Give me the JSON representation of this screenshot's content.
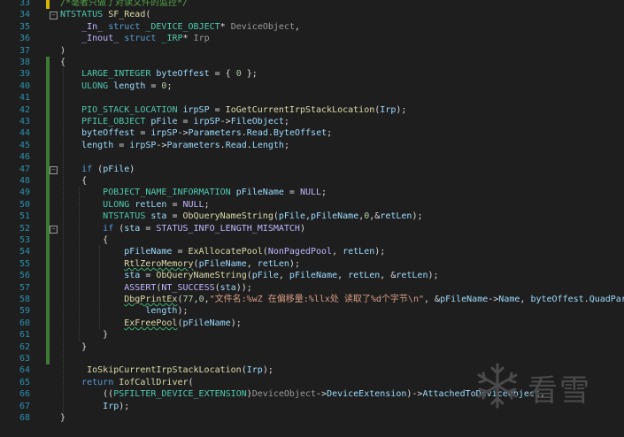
{
  "colors": {
    "background": "#1e1e1e",
    "line_number": "#2b91af",
    "keyword": "#569cd6",
    "type": "#4ec9b0",
    "function": "#dcdcaa",
    "string": "#d69d85",
    "comment": "#57a64a",
    "change_bar": "#3d7a35",
    "change_bar_modified": "#d6b400"
  },
  "lines": [
    {
      "n": "33",
      "tokens": [
        [
          "cm",
          "/*毫者只做了对读文件的监控*/"
        ]
      ]
    },
    {
      "n": "34",
      "tokens": [
        [
          "ty",
          "NTSTATUS"
        ],
        [
          "pl",
          " "
        ],
        [
          "fn",
          "SF_Read"
        ],
        [
          "pl",
          "("
        ]
      ]
    },
    {
      "n": "35",
      "tokens": [
        [
          "pl",
          "    "
        ],
        [
          "mac",
          "_In_"
        ],
        [
          "pl",
          " "
        ],
        [
          "kw",
          "struct"
        ],
        [
          "pl",
          " "
        ],
        [
          "ty",
          "_DEVICE_OBJECT"
        ],
        [
          "pl",
          "* "
        ],
        [
          "gray",
          "DeviceObject"
        ],
        [
          "pl",
          ","
        ]
      ]
    },
    {
      "n": "36",
      "tokens": [
        [
          "pl",
          "    "
        ],
        [
          "mac",
          "_Inout_"
        ],
        [
          "pl",
          " "
        ],
        [
          "kw",
          "struct"
        ],
        [
          "pl",
          " "
        ],
        [
          "ty",
          "_IRP"
        ],
        [
          "pl",
          "* "
        ],
        [
          "gray",
          "Irp"
        ]
      ]
    },
    {
      "n": "37",
      "tokens": [
        [
          "pl",
          ")"
        ]
      ]
    },
    {
      "n": "38",
      "tokens": [
        [
          "pl",
          "{"
        ]
      ]
    },
    {
      "n": "39",
      "tokens": [
        [
          "pl",
          "    "
        ],
        [
          "ty",
          "LARGE_INTEGER"
        ],
        [
          "pl",
          " "
        ],
        [
          "va",
          "byteOffest"
        ],
        [
          "pl",
          " = { "
        ],
        [
          "nu",
          "0"
        ],
        [
          "pl",
          " };"
        ]
      ]
    },
    {
      "n": "40",
      "tokens": [
        [
          "pl",
          "    "
        ],
        [
          "ty",
          "ULONG"
        ],
        [
          "pl",
          " "
        ],
        [
          "va",
          "length"
        ],
        [
          "pl",
          " = "
        ],
        [
          "nu",
          "0"
        ],
        [
          "pl",
          ";"
        ]
      ]
    },
    {
      "n": "41",
      "tokens": [
        [
          "pl",
          ""
        ]
      ]
    },
    {
      "n": "42",
      "tokens": [
        [
          "pl",
          "    "
        ],
        [
          "ty",
          "PIO_STACK_LOCATION"
        ],
        [
          "pl",
          " "
        ],
        [
          "va",
          "irpSP"
        ],
        [
          "pl",
          " = "
        ],
        [
          "fn",
          "IoGetCurrentIrpStackLocation"
        ],
        [
          "pl",
          "("
        ],
        [
          "pa",
          "Irp"
        ],
        [
          "pl",
          ");"
        ]
      ]
    },
    {
      "n": "43",
      "tokens": [
        [
          "pl",
          "    "
        ],
        [
          "ty",
          "PFILE_OBJECT"
        ],
        [
          "pl",
          " "
        ],
        [
          "va",
          "pFile"
        ],
        [
          "pl",
          " = "
        ],
        [
          "va",
          "irpSP"
        ],
        [
          "pl",
          "->"
        ],
        [
          "va",
          "FileObject"
        ],
        [
          "pl",
          ";"
        ]
      ]
    },
    {
      "n": "44",
      "tokens": [
        [
          "pl",
          "    "
        ],
        [
          "va",
          "byteOffest"
        ],
        [
          "pl",
          " = "
        ],
        [
          "va",
          "irpSP"
        ],
        [
          "pl",
          "->"
        ],
        [
          "va",
          "Parameters"
        ],
        [
          "pl",
          "."
        ],
        [
          "va",
          "Read"
        ],
        [
          "pl",
          "."
        ],
        [
          "va",
          "ByteOffset"
        ],
        [
          "pl",
          ";"
        ]
      ]
    },
    {
      "n": "45",
      "tokens": [
        [
          "pl",
          "    "
        ],
        [
          "va",
          "length"
        ],
        [
          "pl",
          " = "
        ],
        [
          "va",
          "irpSP"
        ],
        [
          "pl",
          "->"
        ],
        [
          "va",
          "Parameters"
        ],
        [
          "pl",
          "."
        ],
        [
          "va",
          "Read"
        ],
        [
          "pl",
          "."
        ],
        [
          "va",
          "Length"
        ],
        [
          "pl",
          ";"
        ]
      ]
    },
    {
      "n": "46",
      "tokens": [
        [
          "pl",
          ""
        ]
      ]
    },
    {
      "n": "47",
      "tokens": [
        [
          "pl",
          "    "
        ],
        [
          "kw",
          "if"
        ],
        [
          "pl",
          " ("
        ],
        [
          "va",
          "pFile"
        ],
        [
          "pl",
          ")"
        ]
      ]
    },
    {
      "n": "48",
      "tokens": [
        [
          "pl",
          "    {"
        ]
      ]
    },
    {
      "n": "49",
      "tokens": [
        [
          "pl",
          "        "
        ],
        [
          "ty",
          "POBJECT_NAME_INFORMATION"
        ],
        [
          "pl",
          " "
        ],
        [
          "va",
          "pFileName"
        ],
        [
          "pl",
          " = "
        ],
        [
          "mac",
          "NULL"
        ],
        [
          "pl",
          ";"
        ]
      ]
    },
    {
      "n": "50",
      "tokens": [
        [
          "pl",
          "        "
        ],
        [
          "ty",
          "ULONG"
        ],
        [
          "pl",
          " "
        ],
        [
          "va",
          "retLen"
        ],
        [
          "pl",
          " = "
        ],
        [
          "mac",
          "NULL"
        ],
        [
          "pl",
          ";"
        ]
      ]
    },
    {
      "n": "51",
      "tokens": [
        [
          "pl",
          "        "
        ],
        [
          "ty",
          "NTSTATUS"
        ],
        [
          "pl",
          " "
        ],
        [
          "va",
          "sta"
        ],
        [
          "pl",
          " = "
        ],
        [
          "fn",
          "ObQueryNameString"
        ],
        [
          "pl",
          "("
        ],
        [
          "va",
          "pFile"
        ],
        [
          "pl",
          ","
        ],
        [
          "va",
          "pFileName"
        ],
        [
          "pl",
          ","
        ],
        [
          "nu",
          "0"
        ],
        [
          "pl",
          ",&"
        ],
        [
          "va",
          "retLen"
        ],
        [
          "pl",
          ");"
        ]
      ]
    },
    {
      "n": "52",
      "tokens": [
        [
          "pl",
          "        "
        ],
        [
          "kw",
          "if"
        ],
        [
          "pl",
          " ("
        ],
        [
          "va",
          "sta"
        ],
        [
          "pl",
          " = "
        ],
        [
          "mac",
          "STATUS_INFO_LENGTH_MISMATCH"
        ],
        [
          "pl",
          ")"
        ]
      ]
    },
    {
      "n": "53",
      "tokens": [
        [
          "pl",
          "        {"
        ]
      ]
    },
    {
      "n": "54",
      "tokens": [
        [
          "pl",
          "            "
        ],
        [
          "va",
          "pFileName"
        ],
        [
          "pl",
          " = "
        ],
        [
          "fn",
          "ExAllocatePool"
        ],
        [
          "pl",
          "("
        ],
        [
          "mac",
          "NonPagedPool"
        ],
        [
          "pl",
          ", "
        ],
        [
          "va",
          "retLen"
        ],
        [
          "pl",
          ");"
        ]
      ]
    },
    {
      "n": "55",
      "tokens": [
        [
          "pl",
          "            "
        ],
        [
          "fn",
          "RtlZeroMemory"
        ],
        [
          "pl",
          "("
        ],
        [
          "va",
          "pFileName"
        ],
        [
          "pl",
          ", "
        ],
        [
          "va",
          "retLen"
        ],
        [
          "pl",
          ");"
        ]
      ]
    },
    {
      "n": "56",
      "tokens": [
        [
          "pl",
          "            "
        ],
        [
          "va",
          "sta"
        ],
        [
          "pl",
          " = "
        ],
        [
          "fn",
          "ObQueryNameString"
        ],
        [
          "pl",
          "("
        ],
        [
          "va",
          "pFile"
        ],
        [
          "pl",
          ", "
        ],
        [
          "va",
          "pFileName"
        ],
        [
          "pl",
          ", "
        ],
        [
          "va",
          "retLen"
        ],
        [
          "pl",
          ", &"
        ],
        [
          "va",
          "retLen"
        ],
        [
          "pl",
          ");"
        ]
      ]
    },
    {
      "n": "57",
      "tokens": [
        [
          "pl",
          "            "
        ],
        [
          "mac",
          "ASSERT"
        ],
        [
          "pl",
          "("
        ],
        [
          "mac",
          "NT_SUCCESS"
        ],
        [
          "pl",
          "("
        ],
        [
          "va",
          "sta"
        ],
        [
          "pl",
          "));"
        ]
      ]
    },
    {
      "n": "58",
      "tokens": [
        [
          "pl",
          "            "
        ],
        [
          "fn",
          "DbgPrintEx"
        ],
        [
          "pl",
          "("
        ],
        [
          "nu",
          "77"
        ],
        [
          "pl",
          ","
        ],
        [
          "nu",
          "0"
        ],
        [
          "pl",
          ","
        ],
        [
          "st",
          "\"文件名:%wZ 在偏移量:%llx处 读取了%d个字节\\n\""
        ],
        [
          "pl",
          ", &"
        ],
        [
          "va",
          "pFileName"
        ],
        [
          "pl",
          "->"
        ],
        [
          "va",
          "Name"
        ],
        [
          "pl",
          ", "
        ],
        [
          "va",
          "byteOffest"
        ],
        [
          "pl",
          "."
        ],
        [
          "va",
          "QuadPart"
        ],
        [
          "pl",
          ","
        ]
      ]
    },
    {
      "n": "59",
      "tokens": [
        [
          "pl",
          "                "
        ],
        [
          "va",
          "length"
        ],
        [
          "pl",
          ");"
        ]
      ]
    },
    {
      "n": "60",
      "tokens": [
        [
          "pl",
          "            "
        ],
        [
          "fn",
          "ExFreePool"
        ],
        [
          "pl",
          "("
        ],
        [
          "va",
          "pFileName"
        ],
        [
          "pl",
          ");"
        ]
      ]
    },
    {
      "n": "61",
      "tokens": [
        [
          "pl",
          "        }"
        ]
      ]
    },
    {
      "n": "62",
      "tokens": [
        [
          "pl",
          "    }"
        ]
      ]
    },
    {
      "n": "63",
      "tokens": [
        [
          "pl",
          ""
        ]
      ]
    },
    {
      "n": "64",
      "tokens": [
        [
          "pl",
          "     "
        ],
        [
          "fn",
          "IoSkipCurrentIrpStackLocation"
        ],
        [
          "pl",
          "("
        ],
        [
          "pa",
          "Irp"
        ],
        [
          "pl",
          ");"
        ]
      ]
    },
    {
      "n": "65",
      "tokens": [
        [
          "pl",
          "    "
        ],
        [
          "kw",
          "return"
        ],
        [
          "pl",
          " "
        ],
        [
          "fn",
          "IofCallDriver"
        ],
        [
          "pl",
          "("
        ]
      ]
    },
    {
      "n": "66",
      "tokens": [
        [
          "pl",
          "        (("
        ],
        [
          "ty",
          "PSFILTER_DEVICE_EXTENSION"
        ],
        [
          "pl",
          ")"
        ],
        [
          "gray",
          "DeviceObject"
        ],
        [
          "pl",
          "->"
        ],
        [
          "va",
          "DeviceExtension"
        ],
        [
          "pl",
          ")->"
        ],
        [
          "va",
          "AttachedToDeviceObject"
        ],
        [
          "pl",
          ","
        ]
      ]
    },
    {
      "n": "67",
      "tokens": [
        [
          "pl",
          "        "
        ],
        [
          "pa",
          "Irp"
        ],
        [
          "pl",
          ");"
        ]
      ]
    },
    {
      "n": "68",
      "tokens": [
        [
          "pl",
          "}"
        ]
      ]
    }
  ],
  "watermark": {
    "text": "看雪",
    "icon": "snowflake-icon"
  }
}
